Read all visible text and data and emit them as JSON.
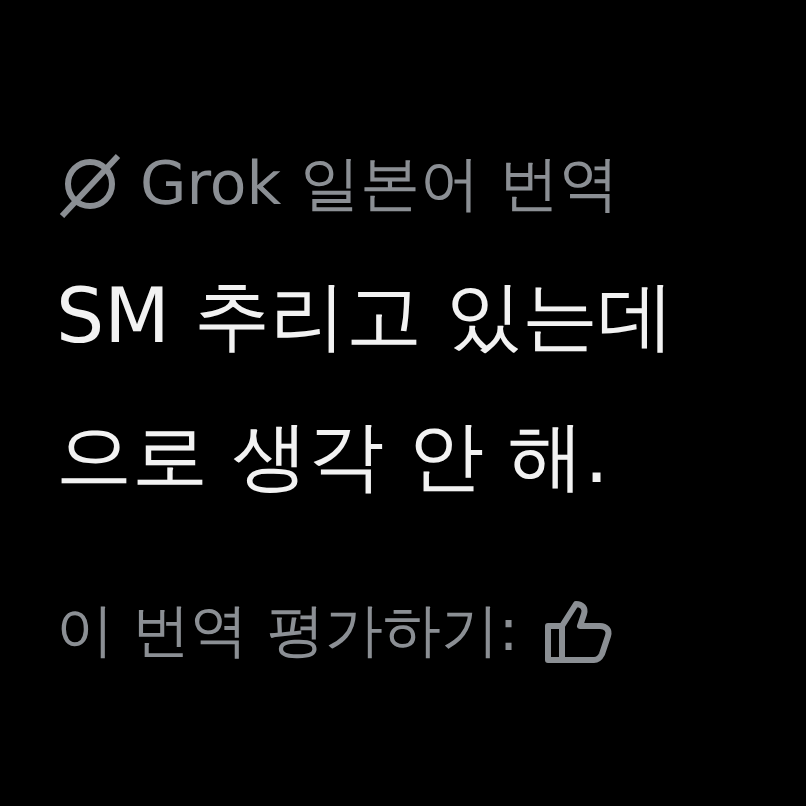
{
  "translation_header": {
    "label": "Grok 일본어 번역"
  },
  "translated_text": [
    "SM 추리고 있는데",
    "으로 생각 안 해."
  ],
  "rating": {
    "prompt": "이 번역 평가하기:"
  }
}
